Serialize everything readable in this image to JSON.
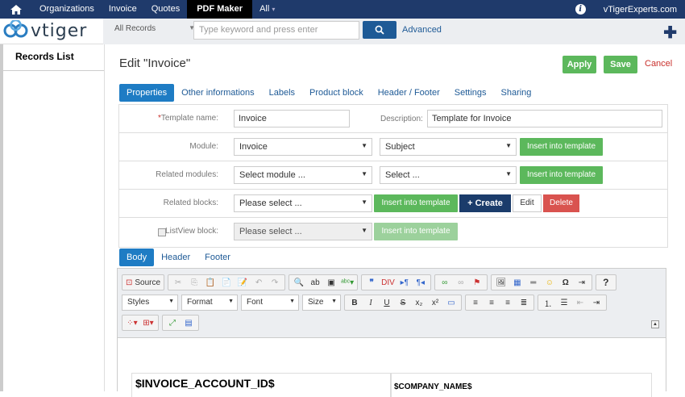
{
  "topbar": {
    "nav": [
      "Organizations",
      "Invoice",
      "Quotes",
      "PDF Maker",
      "All"
    ],
    "active": "PDF Maker",
    "user": "vTigerExperts.com"
  },
  "brand": {
    "name": "vtiger"
  },
  "search": {
    "filter": "All Records",
    "placeholder": "Type keyword and press enter",
    "advanced": "Advanced"
  },
  "sidebar": {
    "title": "Records List"
  },
  "page": {
    "title": "Edit \"Invoice\"",
    "apply": "Apply",
    "save": "Save",
    "cancel": "Cancel",
    "tabs": [
      "Properties",
      "Other informations",
      "Labels",
      "Product block",
      "Header / Footer",
      "Settings",
      "Sharing"
    ]
  },
  "form": {
    "template_label": "Template name:",
    "template_value": "Invoice",
    "description_label": "Description:",
    "description_value": "Template for Invoice",
    "module_label": "Module:",
    "module_value": "Invoice",
    "module_field": "Subject",
    "related_modules_label": "Related modules:",
    "related_modules_value": "Select module ...",
    "related_modules_field": "Select ...",
    "related_blocks_label": "Related blocks:",
    "related_blocks_value": "Please select ...",
    "listview_label": "ListView block:",
    "listview_value": "Please select ...",
    "insert": "Insert into template",
    "create": "+ Create",
    "edit": "Edit",
    "delete": "Delete"
  },
  "body_tabs": [
    "Body",
    "Header",
    "Footer"
  ],
  "editor": {
    "source": "Source",
    "styles": "Styles",
    "format": "Format",
    "font": "Font",
    "size": "Size",
    "help": "?",
    "content_left": "$INVOICE_ACCOUNT_ID$",
    "content_right": "$COMPANY_NAME$"
  }
}
